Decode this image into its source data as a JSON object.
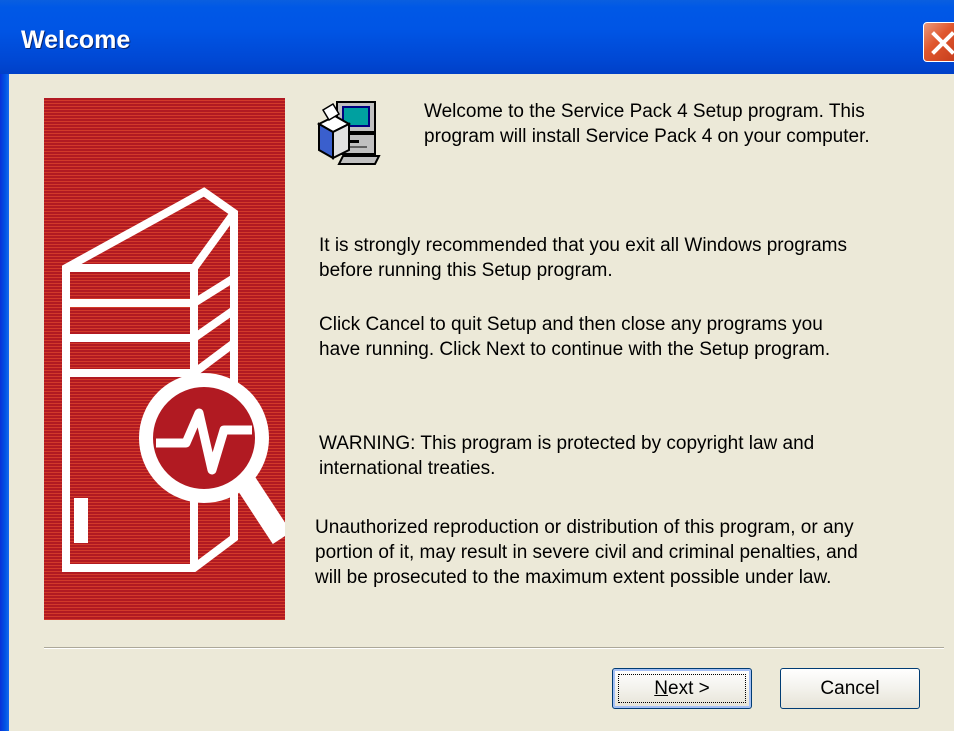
{
  "window": {
    "title": "Welcome"
  },
  "intro": {
    "line1": "Welcome to the Service Pack 4 Setup program.  This",
    "line2": "program will install Service Pack 4 on your computer."
  },
  "recommend": {
    "line1": "It is strongly recommended that you exit all Windows programs",
    "line2": "before running this Setup program."
  },
  "instructions": {
    "line1": "Click Cancel to quit Setup and then close any programs you",
    "line2": "have running.  Click Next to continue with the Setup program."
  },
  "warning": {
    "line1": "WARNING: This program is protected by copyright law and",
    "line2": "international treaties."
  },
  "legal": {
    "line1": "Unauthorized reproduction or distribution of this program, or any",
    "line2": "portion of it, may result in severe civil and criminal penalties, and",
    "line3": "will be prosecuted to the maximum extent possible under law."
  },
  "buttons": {
    "next_mnemonic": "N",
    "next_rest": "ext >",
    "cancel": "Cancel"
  },
  "icons": {
    "close": "close-icon",
    "setup": "setup-computer-icon",
    "banner": "server-magnifier-illustration"
  },
  "colors": {
    "titlebar": "#0055E5",
    "dialog_bg": "#ECE9D8",
    "banner_red": "#B11A22",
    "close_button": "#E0572E"
  }
}
